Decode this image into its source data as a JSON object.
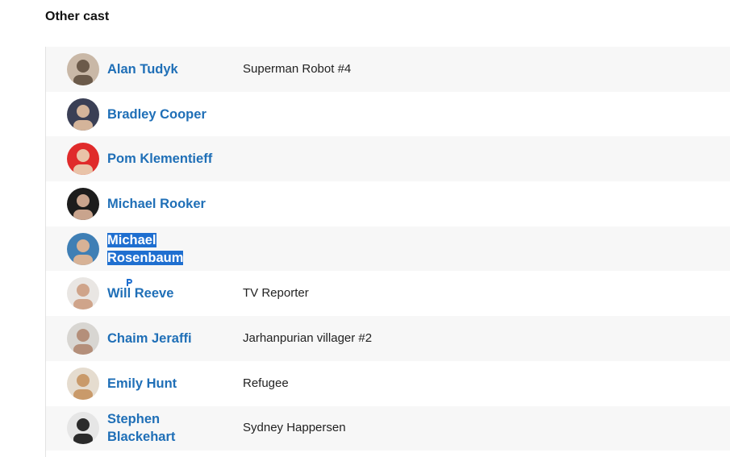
{
  "section": {
    "title": "Other cast"
  },
  "cast": [
    {
      "name": "Alan Tudyk",
      "character": "Superman Robot #4",
      "avatar_bg": "#c9b8a7",
      "avatar_fg": "#6b5a4a",
      "selected": false
    },
    {
      "name": "Bradley Cooper",
      "character": "",
      "avatar_bg": "#3a3f55",
      "avatar_fg": "#d4b49a",
      "selected": false
    },
    {
      "name": "Pom Klementieff",
      "character": "",
      "avatar_bg": "#e02b2b",
      "avatar_fg": "#e9c3a8",
      "selected": false
    },
    {
      "name": "Michael Rooker",
      "character": "",
      "avatar_bg": "#1c1c1c",
      "avatar_fg": "#c9a48d",
      "selected": false
    },
    {
      "name_lines": [
        "Michael",
        "Rosenbaum"
      ],
      "character": "",
      "avatar_bg": "#3f7fb5",
      "avatar_fg": "#d7b296",
      "selected": true
    },
    {
      "name": "Will Reeve",
      "character": "TV Reporter",
      "avatar_bg": "#e9e6e3",
      "avatar_fg": "#cfa48a",
      "selected": false
    },
    {
      "name": "Chaim Jeraffi",
      "character": "Jarhanpurian villager #2",
      "avatar_bg": "#d8d6d2",
      "avatar_fg": "#b48f7a",
      "selected": false
    },
    {
      "name": "Emily Hunt",
      "character": "Refugee",
      "avatar_bg": "#e5dccf",
      "avatar_fg": "#c99a6a",
      "selected": false
    },
    {
      "name_lines": [
        "Stephen",
        "Blackehart"
      ],
      "character": "Sydney Happersen",
      "avatar_bg": "#e6e6e6",
      "avatar_fg": "#2b2b2b",
      "selected": false
    }
  ],
  "colors": {
    "link": "#1f6fb7",
    "selection": "#1f6fd0",
    "stripe": "#f7f7f7"
  }
}
